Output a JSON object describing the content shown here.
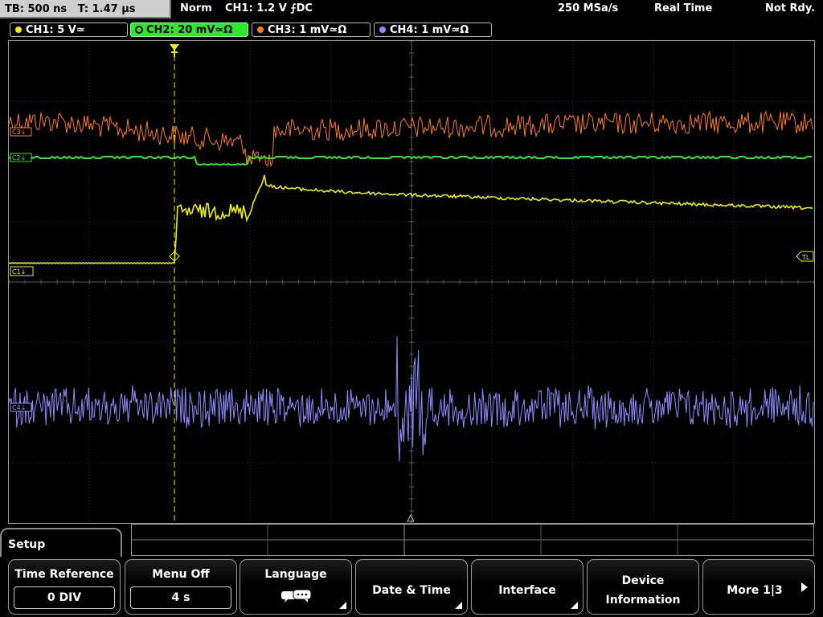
{
  "topbar": {
    "timebase": "TB: 500 ns",
    "trigger_time": "T: 1.47 µs",
    "mode": "Norm",
    "trigger_setting": "CH1: 1.2 V ⨍DC",
    "sample_rate": "250 MSa/s",
    "acq_mode": "Real Time",
    "status": "Not Rdy."
  },
  "channels": [
    {
      "label": "CH1: 5 V≃",
      "color": "#f0f000",
      "active": false
    },
    {
      "label": "CH2: 20 mV≃Ω",
      "color": "#20e020",
      "active": true
    },
    {
      "label": "CH3: 1 mV≃Ω",
      "color": "#ff7a20",
      "active": false
    },
    {
      "label": "CH4: 1 mV≃Ω",
      "color": "#8c8cff",
      "active": false
    }
  ],
  "markers": {
    "ch3": "C3↓",
    "ch2": "C2↓",
    "ch1": "C1↓",
    "ch4": "C4↓",
    "trigger_level": "TL"
  },
  "menu": {
    "title": "Setup",
    "time_reference": {
      "label": "Time Reference",
      "value": "0 DIV"
    },
    "menu_off": {
      "label": "Menu Off",
      "value": "4 s"
    },
    "language": {
      "label": "Language",
      "icon": "speech-bubbles-icon"
    },
    "date_time": {
      "label": "Date & Time"
    },
    "interface": {
      "label": "Interface"
    },
    "device_info": {
      "label_line1": "Device",
      "label_line2": "Information"
    },
    "more": {
      "label": "More 1|3"
    }
  }
}
